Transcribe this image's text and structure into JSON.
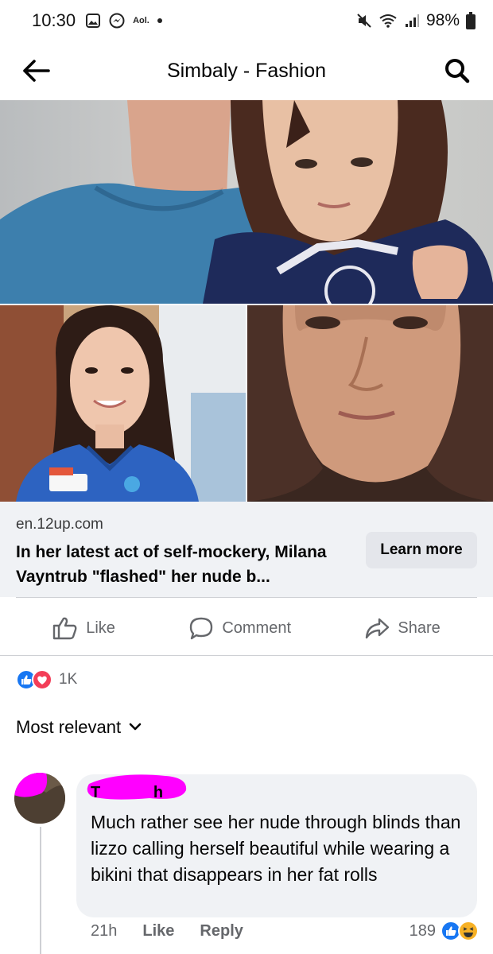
{
  "status_bar": {
    "time": "10:30",
    "carrier": "Aol.",
    "battery": "98%"
  },
  "header": {
    "title": "Simbaly - Fashion"
  },
  "link_preview": {
    "domain": "en.12up.com",
    "title": "In her latest act of self-mockery, Milana Vayntrub \"flashed\" her nude b...",
    "cta_label": "Learn more"
  },
  "actions": {
    "like": "Like",
    "comment": "Comment",
    "share": "Share"
  },
  "reactions": {
    "count": "1K"
  },
  "sort": {
    "label": "Most relevant"
  },
  "comment": {
    "author_visible": "T            h",
    "text": "Much rather see her nude through blinds than lizzo calling herself beautiful while wearing a bikini that disappears in her fat rolls",
    "time": "21h",
    "like_label": "Like",
    "reply_label": "Reply",
    "reaction_count": "189"
  },
  "colors": {
    "facebook_blue": "#1877f2",
    "love_red": "#f33e58",
    "haha_yellow": "#f7b125",
    "redaction_magenta": "#ff00ff"
  }
}
